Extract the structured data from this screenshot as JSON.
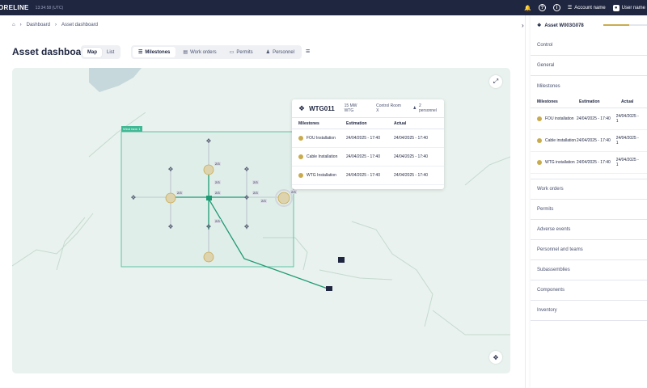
{
  "topbar": {
    "brand": "ORELINE",
    "clock": "13:34:58 (UTC)",
    "account": "Account name",
    "user": "User name"
  },
  "breadcrumbs": [
    "Dashboard",
    "Asset dashboard"
  ],
  "page": {
    "title": "Asset dashboard"
  },
  "view_toggle": {
    "map": "Map",
    "list": "List"
  },
  "tabs": [
    "Milestones",
    "Work orders",
    "Permits",
    "Personnel"
  ],
  "map": {
    "farm_label": "Wind farm 1",
    "badges": [
      "2/3",
      "2/3",
      "2/3",
      "2/3",
      "2/3",
      "2/3",
      "2/3",
      "2/3",
      "2/3"
    ]
  },
  "popup": {
    "name": "WTG011",
    "rating": "15 MW WTG",
    "control_room": "Control Room X",
    "personnel": "2 personnel",
    "columns": [
      "Milestones",
      "Estimation",
      "Actual"
    ],
    "rows": [
      {
        "name": "FOU Installation",
        "estimation": "24/04/2025 - 17:40",
        "actual": "24/04/2025 - 17:40"
      },
      {
        "name": "Cable Installation",
        "estimation": "24/04/2025 - 17:40",
        "actual": "24/04/2025 - 17:40"
      },
      {
        "name": "WTG Installation",
        "estimation": "24/04/2025 - 17:40",
        "actual": "24/04/2025 - 17:40"
      }
    ]
  },
  "panel": {
    "asset": "Asset W003G078",
    "progress": 0.6,
    "control": "Control",
    "general": "General",
    "milestones_title": "Milestones",
    "columns": [
      "Milestones",
      "Estimation",
      "Actual"
    ],
    "rows": [
      {
        "name": "FOU installation",
        "estimation": "24/04/2025 - 17:40",
        "actual": "24/04/2025 - 1"
      },
      {
        "name": "Cable installation",
        "estimation": "24/04/2025 - 17:40",
        "actual": "24/04/2025 - 1"
      },
      {
        "name": "WTG installation",
        "estimation": "24/04/2025 - 17:40",
        "actual": "24/04/2025 - 1"
      }
    ],
    "sections": [
      "Work orders",
      "Permits",
      "Adverse events",
      "Personnel and teams",
      "Subassemblies",
      "Components",
      "Inventory"
    ]
  },
  "colors": {
    "topbar": "#1f2640",
    "accent": "#c9ab4e",
    "cable": "#1f9a74",
    "farm": "#40b894"
  }
}
